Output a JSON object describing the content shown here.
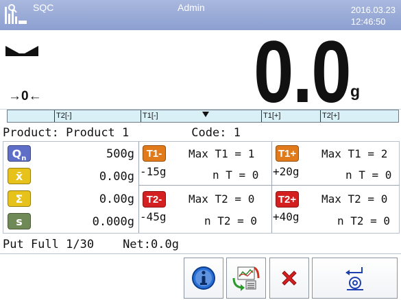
{
  "header": {
    "app_name": "SQC",
    "user": "Admin",
    "date": "2016.03.23",
    "time": "12:46:50",
    "logo_icon": "balance-logo-icon",
    "bg_color": "#9aabd8"
  },
  "display": {
    "stability_icon": "stable-indicator-icon",
    "zero_indicator": "→0←",
    "weight": "0.0",
    "unit": "g"
  },
  "threshold_bar": {
    "labels": [
      "T2[-]",
      "T1[-]",
      "T1[+]",
      "T2[+]"
    ],
    "marker_icon": "pointer-triangle-icon"
  },
  "product_line": {
    "product_label": "Product:",
    "product_name": "Product 1",
    "code_label": "Code:",
    "code_value": "1"
  },
  "stats": [
    {
      "icon": "Qn",
      "icon_name": "quantity-icon",
      "color": "#5f6fc8",
      "value": "500g"
    },
    {
      "icon": "x̄",
      "icon_name": "mean-icon",
      "color": "#e6c21a",
      "value": "0.00g"
    },
    {
      "icon": "Σ",
      "icon_name": "sum-icon",
      "color": "#e6c21a",
      "value": "0.00g"
    },
    {
      "icon": "s",
      "icon_name": "std-dev-icon",
      "color": "#6f8a57",
      "value": "0.000g"
    }
  ],
  "thresholds": {
    "t1_minus": {
      "badge": "T1-",
      "color": "#e07a1a",
      "max": "Max T1 = 1",
      "value": "-15g",
      "count": "n T = 0"
    },
    "t1_plus": {
      "badge": "T1+",
      "color": "#e07a1a",
      "max": "Max T1 = 2",
      "value": "+20g",
      "count": "n T = 0"
    },
    "t2_minus": {
      "badge": "T2-",
      "color": "#d42020",
      "max": "Max T2 = 0",
      "value": "-45g",
      "count": "n T2 = 0"
    },
    "t2_plus": {
      "badge": "T2+",
      "color": "#d42020",
      "max": "Max T2 = 0",
      "value": "+40g",
      "count": "n T2 = 0"
    }
  },
  "status": {
    "put_full": "Put Full 1/30",
    "net": "Net:0.0g"
  },
  "footer_buttons": [
    {
      "name": "info-button",
      "icon": "info-icon"
    },
    {
      "name": "exchange-button",
      "icon": "exchange-icon"
    },
    {
      "name": "cancel-button",
      "icon": "cancel-x-icon"
    },
    {
      "name": "tare-button",
      "icon": "tare-icon"
    }
  ]
}
